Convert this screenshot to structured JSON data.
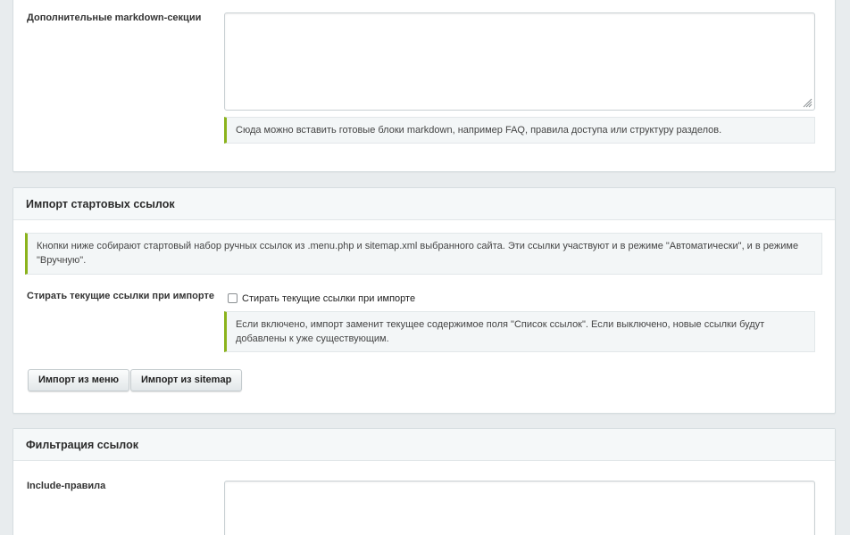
{
  "section_markdown": {
    "field_label": "Дополнительные markdown-секции",
    "textarea_value": "",
    "hint": "Сюда можно вставить готовые блоки markdown, например FAQ, правила доступа или структуру разделов."
  },
  "section_import": {
    "title": "Импорт стартовых ссылок",
    "notice": "Кнопки ниже собирают стартовый набор ручных ссылок из .menu.php и sitemap.xml выбранного сайта. Эти ссылки участвуют и в режиме \"Автоматически\", и в режиме \"Вручную\".",
    "erase_field_label": "Стирать текущие ссылки при импорте",
    "erase_checkbox_label": "Стирать текущие ссылки при импорте",
    "erase_checked": false,
    "erase_hint": "Если включено, импорт заменит текущее содержимое поля \"Список ссылок\". Если выключено, новые ссылки будут добавлены к уже существующим.",
    "buttons": {
      "import_menu": "Импорт из меню",
      "import_sitemap": "Импорт из sitemap"
    }
  },
  "section_filter": {
    "title": "Фильтрация ссылок",
    "include_label": "Include-правила",
    "include_value": ""
  },
  "colors": {
    "accent": "#8bb31c",
    "page_bg": "#e8ecee",
    "panel_header_bg": "#f5f8f9"
  }
}
